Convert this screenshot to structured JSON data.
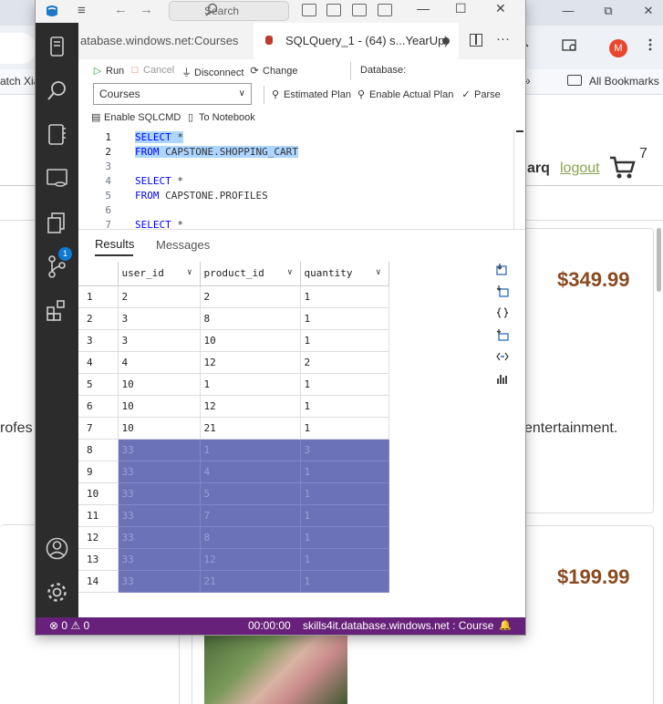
{
  "browser": {
    "bookmark_left_text": "atch Xia",
    "bookmarks_all": "All Bookmarks",
    "bookmark_chevron": "»",
    "avatar_letter": "M",
    "window_controls": [
      "—",
      "⧉",
      "✕"
    ],
    "site": {
      "user_text": "arq",
      "logout": "logout",
      "cart_count": "7",
      "products": [
        {
          "price": "$349.99",
          "desc_left": "rofes",
          "desc_right": "entertainment."
        },
        {
          "price": "$199.99"
        }
      ]
    }
  },
  "ads": {
    "titlebar": {
      "search_placeholder": "Search",
      "menu_glyph": "≡",
      "back_glyph": "←",
      "fwd_glyph": "→",
      "minimize": "—",
      "restore": "☐",
      "close": "✕"
    },
    "tabs": [
      {
        "label": "atabase.windows.net:Courses"
      },
      {
        "label": "SQLQuery_1 - (64) s...YearUp)"
      }
    ],
    "tab_more": "···",
    "toolbar": {
      "run": "Run",
      "cancel": "Cancel",
      "disconnect": "Disconnect",
      "change": "Change",
      "database_label": "Database:",
      "database_value": "Courses",
      "estimated_plan": "Estimated Plan",
      "enable_actual_plan": "Enable Actual Plan",
      "parse": "Parse",
      "enable_sqlcmd": "Enable SQLCMD",
      "to_notebook": "To Notebook"
    },
    "editor": {
      "lines": [
        {
          "n": "1",
          "kw": "SELECT",
          "rest": " *"
        },
        {
          "n": "2",
          "kw": "FROM",
          "rest": " CAPSTONE.SHOPPING_CART"
        },
        {
          "n": "3",
          "kw": "",
          "rest": ""
        },
        {
          "n": "4",
          "kw": "SELECT",
          "rest": " *"
        },
        {
          "n": "5",
          "kw": "FROM",
          "rest": " CAPSTONE.PROFILES"
        },
        {
          "n": "6",
          "kw": "",
          "rest": ""
        },
        {
          "n": "7",
          "kw": "SELECT",
          "rest": " *"
        }
      ]
    },
    "results": {
      "tab_results": "Results",
      "tab_messages": "Messages",
      "columns": [
        "user_id",
        "product_id",
        "quantity"
      ],
      "rows": [
        [
          "1",
          "2",
          "2",
          "1"
        ],
        [
          "2",
          "3",
          "8",
          "1"
        ],
        [
          "3",
          "3",
          "10",
          "1"
        ],
        [
          "4",
          "4",
          "12",
          "2"
        ],
        [
          "5",
          "10",
          "1",
          "1"
        ],
        [
          "6",
          "10",
          "12",
          "1"
        ],
        [
          "7",
          "10",
          "21",
          "1"
        ],
        [
          "8",
          "33",
          "1",
          "3"
        ],
        [
          "9",
          "33",
          "4",
          "1"
        ],
        [
          "10",
          "33",
          "5",
          "1"
        ],
        [
          "11",
          "33",
          "7",
          "1"
        ],
        [
          "12",
          "33",
          "8",
          "1"
        ],
        [
          "13",
          "33",
          "12",
          "1"
        ],
        [
          "14",
          "33",
          "21",
          "1"
        ]
      ]
    },
    "activity_badge": "1",
    "status": {
      "errors": "0",
      "warnings": "0",
      "elapsed": "00:00:00",
      "connection": "skills4it.database.windows.net : Course",
      "error_glyph": "⊗",
      "warning_glyph": "⚠",
      "bell_glyph": "🔔"
    }
  }
}
